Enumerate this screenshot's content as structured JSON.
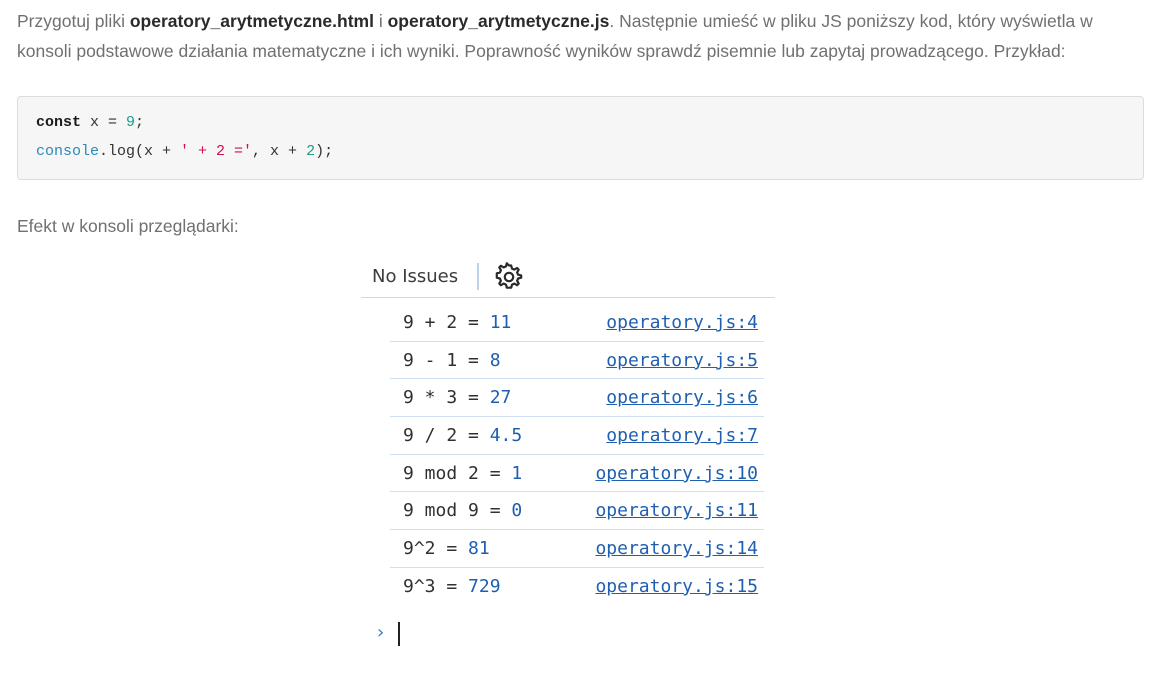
{
  "intro": {
    "t1": "Przygotuj pliki ",
    "file_html": "operatory_arytmetyczne.html",
    "t2": " i ",
    "file_js": "operatory_arytmetyczne.js",
    "t3": ". Następnie umieść w pliku JS poniższy kod, który wyświetla w konsoli podstawowe działania matematyczne i ich wyniki. Poprawność wyników sprawdź pisemnie lub zapytaj prowadzącego. Przykład:"
  },
  "code": {
    "line1": {
      "kw": "const",
      "a": " x = ",
      "num": "9",
      "b": ";"
    },
    "line2": {
      "fn": "console",
      "a": ".log(x + ",
      "str": "' + 2 ='",
      "b": ", x + ",
      "num": "2",
      "c": ");"
    }
  },
  "effect_label": "Efekt w konsoli przeglądarki:",
  "console": {
    "toolbar_label": "No Issues",
    "rows": [
      {
        "expr": "9 + 2 = ",
        "value": "11",
        "link": "operatory.js:4"
      },
      {
        "expr": "9 - 1 = ",
        "value": "8",
        "link": "operatory.js:5"
      },
      {
        "expr": "9 * 3 = ",
        "value": "27",
        "link": "operatory.js:6"
      },
      {
        "expr": "9 / 2 = ",
        "value": "4.5",
        "link": "operatory.js:7"
      },
      {
        "expr": "9 mod 2 = ",
        "value": "1",
        "link": "operatory.js:10"
      },
      {
        "expr": "9 mod 9 = ",
        "value": "0",
        "link": "operatory.js:11"
      },
      {
        "expr": "9^2 = ",
        "value": "81",
        "link": "operatory.js:14"
      },
      {
        "expr": "9^3 = ",
        "value": "729",
        "link": "operatory.js:15"
      }
    ],
    "prompt_glyph": "›"
  }
}
